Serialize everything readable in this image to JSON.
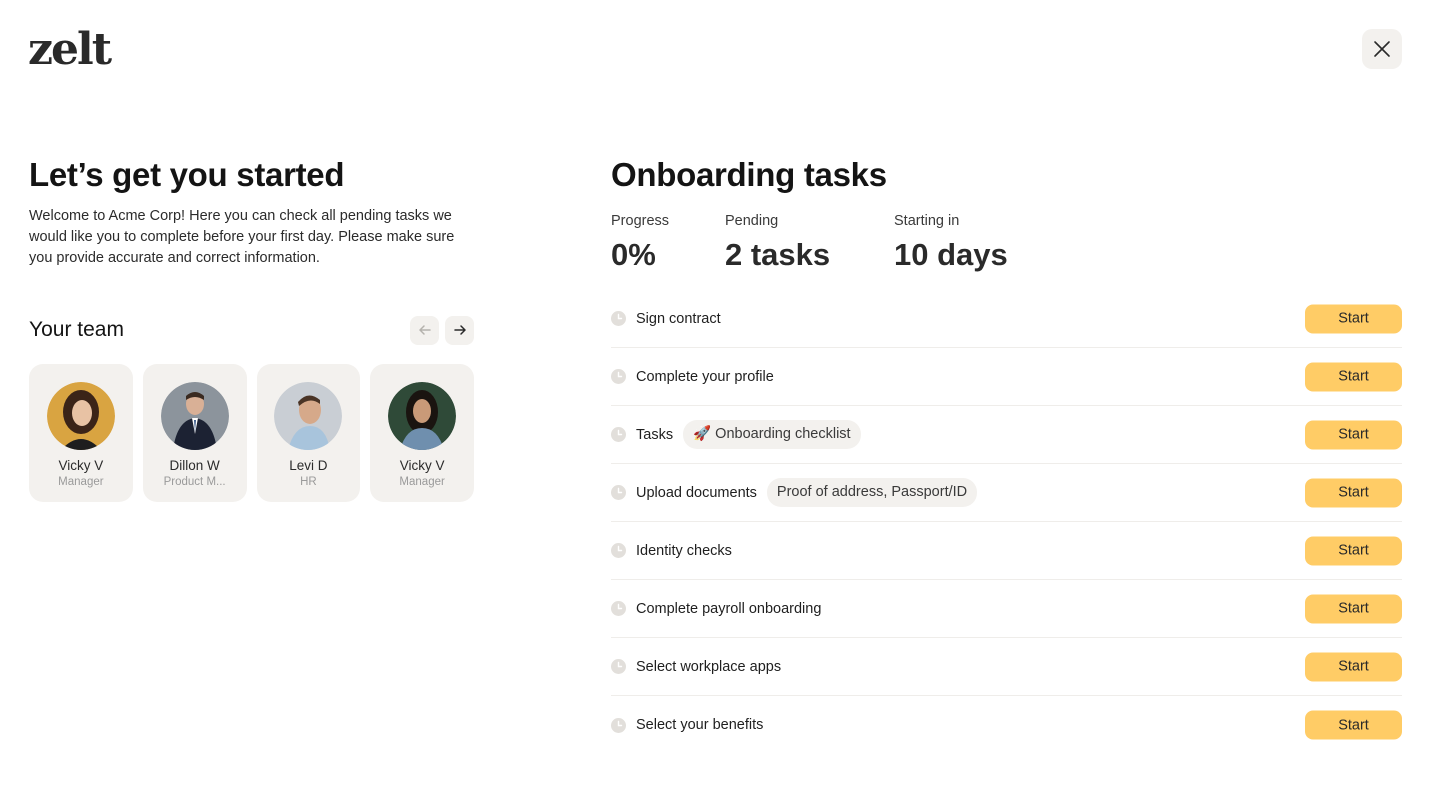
{
  "brand": {
    "logo_text": "zelt"
  },
  "intro": {
    "title": "Let’s get you started",
    "text": "Welcome to Acme Corp! Here you can check all pending tasks we would like you to complete before your first day. Please make sure you provide accurate and correct information."
  },
  "team": {
    "title": "Your team",
    "members": [
      {
        "name": "Vicky V",
        "role": "Manager"
      },
      {
        "name": "Dillon W",
        "role": "Product M..."
      },
      {
        "name": "Levi D",
        "role": "HR"
      },
      {
        "name": "Vicky V",
        "role": "Manager"
      }
    ]
  },
  "onboarding": {
    "title": "Onboarding tasks",
    "stats": [
      {
        "label": "Progress",
        "value": "0%"
      },
      {
        "label": "Pending",
        "value": "2 tasks"
      },
      {
        "label": "Starting in",
        "value": "10 days"
      }
    ],
    "tasks": [
      {
        "name": "Sign contract",
        "chip": "",
        "action": "Start"
      },
      {
        "name": "Complete your profile",
        "chip": "",
        "action": "Start"
      },
      {
        "name": "Tasks",
        "chip": "🚀 Onboarding checklist",
        "action": "Start"
      },
      {
        "name": "Upload documents",
        "chip": "Proof of address, Passport/ID",
        "action": "Start"
      },
      {
        "name": "Identity checks",
        "chip": "",
        "action": "Start"
      },
      {
        "name": "Complete payroll onboarding",
        "chip": "",
        "action": "Start"
      },
      {
        "name": "Select workplace apps",
        "chip": "",
        "action": "Start"
      },
      {
        "name": "Select your benefits",
        "chip": "",
        "action": "Start"
      }
    ]
  },
  "icons": {
    "close": "close-icon",
    "prev": "arrow-left-icon",
    "next": "arrow-right-icon",
    "task_status": "clock-icon"
  },
  "colors": {
    "accent": "#ffcc66",
    "surface": "#f3f1ee",
    "text": "#1f1f1f",
    "muted": "#9a9a9a"
  }
}
